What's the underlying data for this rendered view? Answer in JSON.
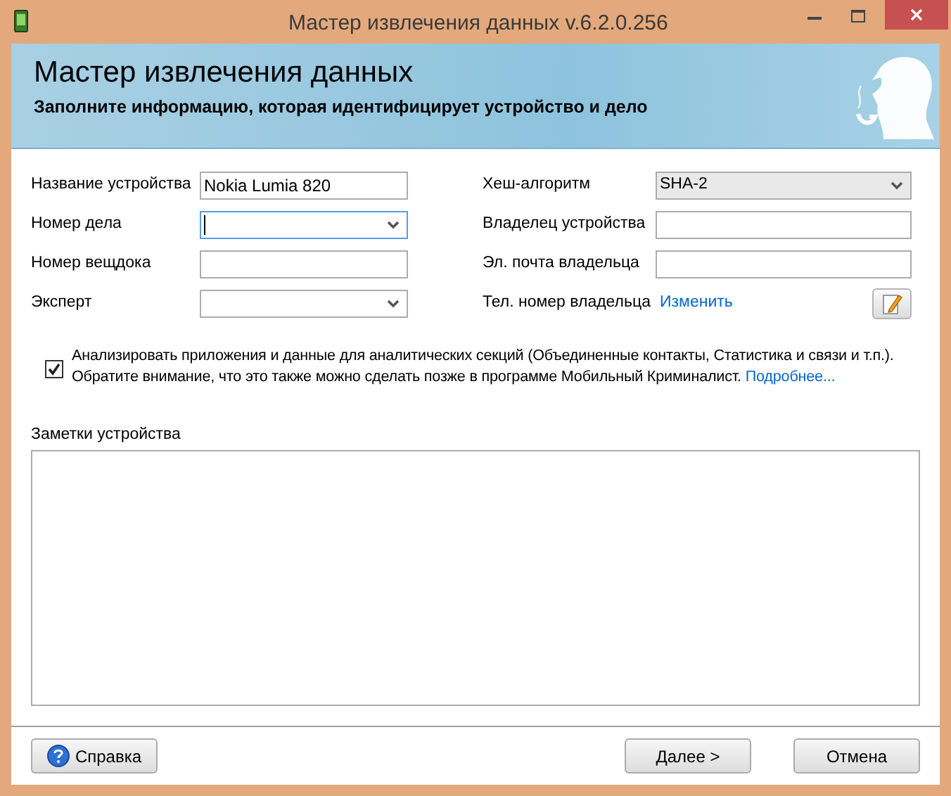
{
  "window": {
    "title": "Мастер извлечения данных v.6.2.0.256"
  },
  "header": {
    "title": "Мастер извлечения данных",
    "subtitle": "Заполните информацию, которая идентифицирует устройство и дело"
  },
  "left_fields": [
    {
      "label": "Название устройства",
      "kind": "text",
      "value": "Nokia Lumia 820",
      "focused": false
    },
    {
      "label": "Номер дела",
      "kind": "combo",
      "focused": true
    },
    {
      "label": "Номер вещдока",
      "kind": "text",
      "focused": false
    },
    {
      "label": "Эксперт",
      "kind": "combo",
      "focused": false
    }
  ],
  "right_fields": [
    {
      "label": "Хеш-алгоритм",
      "kind": "dropdown",
      "value": "SHA-2",
      "focused": false
    },
    {
      "label": "Владелец устройства",
      "kind": "text",
      "focused": false
    },
    {
      "label": "Эл. почта владельца",
      "kind": "text",
      "focused": false
    },
    {
      "label": "Тел. номер владельца",
      "kind": "link",
      "link": "Изменить"
    }
  ],
  "analyze": {
    "checked": true,
    "text": "Анализировать приложения и данные для аналитических секций (Объединенные контакты, Статистика и связи и т.п.). Обратите внимание, что это также можно сделать позже в программе Мобильный Криминалист.",
    "link": "Подробнее..."
  },
  "notes": {
    "label": "Заметки устройства"
  },
  "buttons": [
    {
      "label": "Справка",
      "kind": "help"
    },
    {
      "label": "Далее >",
      "kind": "next"
    },
    {
      "label": "Отмена",
      "kind": "cancel"
    }
  ]
}
